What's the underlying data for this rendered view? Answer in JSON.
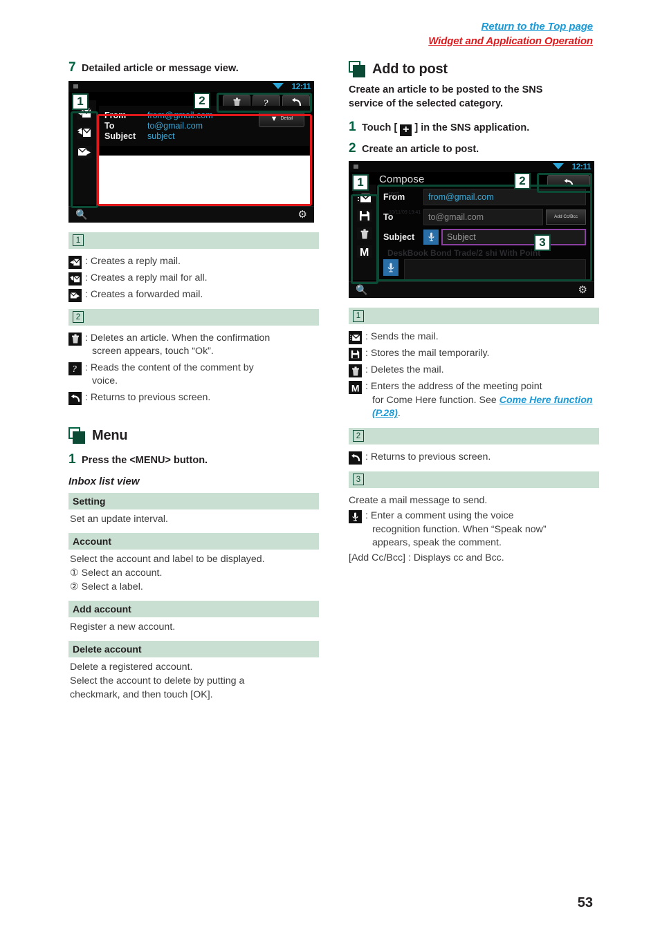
{
  "header": {
    "top_link": "Return to the Top page",
    "sub_link": "Widget and Application Operation"
  },
  "page_number": "53",
  "left_column": {
    "step7": {
      "num": "7",
      "title": "Detailed article or message view."
    },
    "device_detail": {
      "status_time": "12:11",
      "wifi_icon": "wifi-icon",
      "from_label": "From",
      "from_value": "from@gmail.com",
      "to_label": "To",
      "to_value": "to@gmail.com",
      "subject_label": "Subject",
      "subject_value": "subject",
      "detail_button": "Detail",
      "rail_icons": [
        "reply-mail-icon",
        "reply-all-mail-icon",
        "forward-mail-icon"
      ],
      "toolbar_icons": [
        "trash-icon",
        "read-aloud-icon",
        "return-icon"
      ],
      "callout_1": "1",
      "callout_2": "2"
    },
    "legend_1": {
      "label": "1",
      "items": [
        {
          "icon": "reply-mail-icon",
          "glyph": "✉",
          "text": ": Creates a reply mail."
        },
        {
          "icon": "reply-all-mail-icon",
          "glyph": "✉",
          "text": ": Creates a reply mail for all."
        },
        {
          "icon": "forward-mail-icon",
          "glyph": "✉",
          "text": ": Creates a forwarded mail."
        }
      ]
    },
    "legend_2": {
      "label": "2",
      "items": [
        {
          "icon": "trash-icon",
          "glyph": "🗑",
          "text": ": Deletes an article. When the confirmation",
          "text2": "screen appears, touch “Ok”."
        },
        {
          "icon": "read-aloud-icon",
          "glyph": "?",
          "text": ": Reads the content of the comment by",
          "text2": "voice."
        },
        {
          "icon": "return-icon",
          "glyph": "↶",
          "text": ": Returns to previous screen.",
          "text2": ""
        }
      ]
    },
    "menu_section": {
      "title": "Menu",
      "step": {
        "num": "1",
        "title": "Press the <MENU> button."
      },
      "subtitle": "Inbox list view",
      "rows": [
        {
          "head": "Setting",
          "lines": [
            "Set an update interval."
          ]
        },
        {
          "head": "Account",
          "lines": [
            "Select the account and label to be displayed.",
            "① Select an account.",
            "② Select a label."
          ]
        },
        {
          "head": "Add account",
          "lines": [
            "Register a new account."
          ]
        },
        {
          "head": "Delete account",
          "lines": [
            "Delete a registered account.",
            "Select the account to delete by putting a",
            "checkmark, and then touch [OK]."
          ]
        }
      ]
    }
  },
  "right_column": {
    "section": {
      "title": "Add to post",
      "intro_line1": "Create an article to be posted to the SNS",
      "intro_line2": "service of the selected category."
    },
    "step1": {
      "num": "1",
      "pre": "Touch [",
      "icon": "plus-icon",
      "post": "] in the SNS application."
    },
    "step2": {
      "num": "2",
      "title": "Create an article to post."
    },
    "device_compose": {
      "status_time": "12:11",
      "title": "Compose",
      "from_label": "From",
      "from_value": "from@gmail.com",
      "to_label": "To",
      "to_value": "to@gmail.com",
      "subject_label": "Subject",
      "subject_placeholder": "Subject",
      "add_ccbcc_button": "Add Cc/Bcc",
      "ghost_text": "DeskBook   Bond Trade/2  shi        With Point",
      "ghost_from": "test",
      "ghost_to": "10/11/09 19:41",
      "rail_icons": [
        "send-mail-icon",
        "save-icon",
        "trash-icon",
        "come-here-icon"
      ],
      "toolbar_icons": [
        "return-icon"
      ],
      "callout_1": "1",
      "callout_2": "2",
      "callout_3": "3"
    },
    "legend_1": {
      "label": "1",
      "items": [
        {
          "icon": "send-mail-icon",
          "glyph": "✉",
          "text": ": Sends the mail.",
          "text2": ""
        },
        {
          "icon": "save-icon",
          "glyph": "💾",
          "text": ": Stores the mail temporarily.",
          "text2": ""
        },
        {
          "icon": "trash-icon",
          "glyph": "🗑",
          "text": ": Deletes the mail.",
          "text2": ""
        },
        {
          "icon": "come-here-icon",
          "glyph": "M",
          "text": ": Enters the address of the meeting point",
          "text2": "for Come Here function. See ",
          "link": "Come Here function (P.28)",
          "text3": "."
        }
      ]
    },
    "legend_2": {
      "label": "2",
      "items": [
        {
          "icon": "return-icon",
          "glyph": "↶",
          "text": ": Returns to previous screen."
        }
      ]
    },
    "legend_3": {
      "label": "3",
      "line1": "Create a mail message to send.",
      "mic_item": {
        "icon": "mic-icon",
        "glyph": "🎤",
        "text": ": Enter a comment using the voice",
        "text2": "recognition function. When “Speak now”",
        "text3": "appears, speak the comment."
      },
      "last_line": "[Add Cc/Bcc] : Displays cc and Bcc."
    }
  }
}
